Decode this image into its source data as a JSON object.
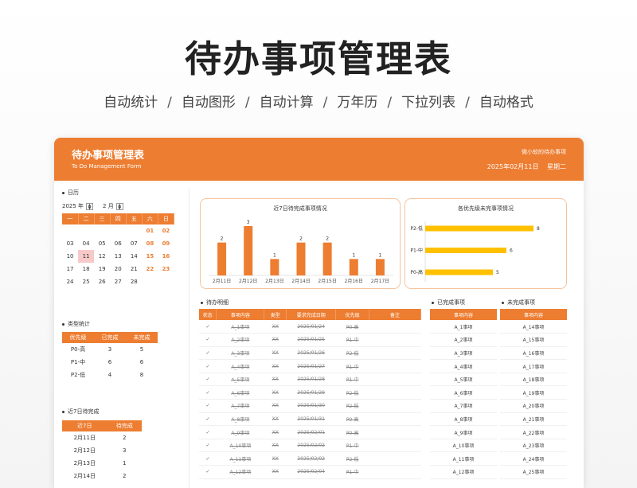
{
  "hero": {
    "title": "待办事项管理表",
    "features": [
      "自动统计",
      "自动图形",
      "自动计算",
      "万年历",
      "下拉列表",
      "自动格式"
    ],
    "separator": "/"
  },
  "header": {
    "title": "待办事项管理表",
    "subtitle": "To Do Management Form",
    "owner": "微小软的待办事项",
    "date": "2025年02月11日",
    "weekday": "星期二"
  },
  "calendar": {
    "section_label": "日历",
    "year": "2025 年",
    "month": "2 月",
    "weekdays": [
      "一",
      "二",
      "三",
      "四",
      "五",
      "六",
      "日"
    ],
    "weeks": [
      [
        "",
        "",
        "",
        "",
        "",
        "01",
        "02"
      ],
      [
        "03",
        "04",
        "05",
        "06",
        "07",
        "08",
        "09"
      ],
      [
        "10",
        "11",
        "12",
        "13",
        "14",
        "15",
        "16"
      ],
      [
        "17",
        "18",
        "19",
        "20",
        "21",
        "22",
        "23"
      ],
      [
        "24",
        "25",
        "26",
        "27",
        "28",
        "",
        ""
      ]
    ],
    "today": "11"
  },
  "type_stats": {
    "section_label": "类型统计",
    "headers": [
      "优先级",
      "已完成",
      "未完成"
    ],
    "rows": [
      [
        "P0-高",
        "3",
        "5"
      ],
      [
        "P1-中",
        "6",
        "6"
      ],
      [
        "P2-低",
        "4",
        "8"
      ]
    ]
  },
  "recent7": {
    "section_label": "近7日待完成",
    "headers": [
      "近7日",
      "待完成"
    ],
    "rows": [
      [
        "2月11日",
        "2"
      ],
      [
        "2月12日",
        "3"
      ],
      [
        "2月13日",
        "1"
      ],
      [
        "2月14日",
        "2"
      ]
    ]
  },
  "chart_data": [
    {
      "type": "bar",
      "title": "近7日待完成事项情况",
      "categories": [
        "2月11日",
        "2月12日",
        "2月13日",
        "2月14日",
        "2月15日",
        "2月16日",
        "2月17日"
      ],
      "values": [
        2,
        3,
        1,
        2,
        2,
        1,
        1
      ],
      "ylim": [
        0,
        3
      ],
      "color": "#ed7d31"
    },
    {
      "type": "bar",
      "orientation": "horizontal",
      "title": "各优先级未完事项情况",
      "categories": [
        "P2-低",
        "P1-中",
        "P0-高"
      ],
      "values": [
        8,
        6,
        5
      ],
      "xlim": [
        0,
        8
      ],
      "color": "#ffc000"
    }
  ],
  "todo": {
    "section_label": "待办明细",
    "headers": [
      "状态",
      "事项内容",
      "类型",
      "要求完成日期",
      "优先级",
      "备注"
    ],
    "rows": [
      [
        "✓",
        "A_1事项",
        "XX",
        "2025/01/24",
        "P0-高",
        ""
      ],
      [
        "✓",
        "A_2事项",
        "XX",
        "2025/01/25",
        "P1-中",
        ""
      ],
      [
        "✓",
        "A_3事项",
        "XX",
        "2025/01/26",
        "P2-低",
        ""
      ],
      [
        "✓",
        "A_4事项",
        "XX",
        "2025/01/27",
        "P1-中",
        ""
      ],
      [
        "✓",
        "A_5事项",
        "XX",
        "2025/01/28",
        "P1-中",
        ""
      ],
      [
        "✓",
        "A_6事项",
        "XX",
        "2025/01/29",
        "P2-低",
        ""
      ],
      [
        "✓",
        "A_7事项",
        "XX",
        "2025/01/30",
        "P2-低",
        ""
      ],
      [
        "✓",
        "A_8事项",
        "XX",
        "2025/01/31",
        "P0-高",
        ""
      ],
      [
        "✓",
        "A_9事项",
        "XX",
        "2025/02/01",
        "P0-高",
        ""
      ],
      [
        "✓",
        "A_10事项",
        "XX",
        "2025/02/02",
        "P1-中",
        ""
      ],
      [
        "✓",
        "A_11事项",
        "XX",
        "2025/02/02",
        "P2-低",
        ""
      ],
      [
        "✓",
        "A_12事项",
        "XX",
        "2025/02/04",
        "P1-中",
        ""
      ]
    ]
  },
  "done_list": {
    "section_label": "已完成事项",
    "header": "事项内容",
    "items": [
      "A_1事项",
      "A_2事项",
      "A_3事项",
      "A_4事项",
      "A_5事项",
      "A_6事项",
      "A_7事项",
      "A_8事项",
      "A_9事项",
      "A_10事项",
      "A_11事项",
      "A_12事项"
    ]
  },
  "undone_list": {
    "section_label": "未完成事项",
    "header": "事项内容",
    "items": [
      "A_14事项",
      "A_15事项",
      "A_16事项",
      "A_17事项",
      "A_18事项",
      "A_19事项",
      "A_20事项",
      "A_21事项",
      "A_22事项",
      "A_23事项",
      "A_24事项",
      "A_25事项"
    ]
  }
}
